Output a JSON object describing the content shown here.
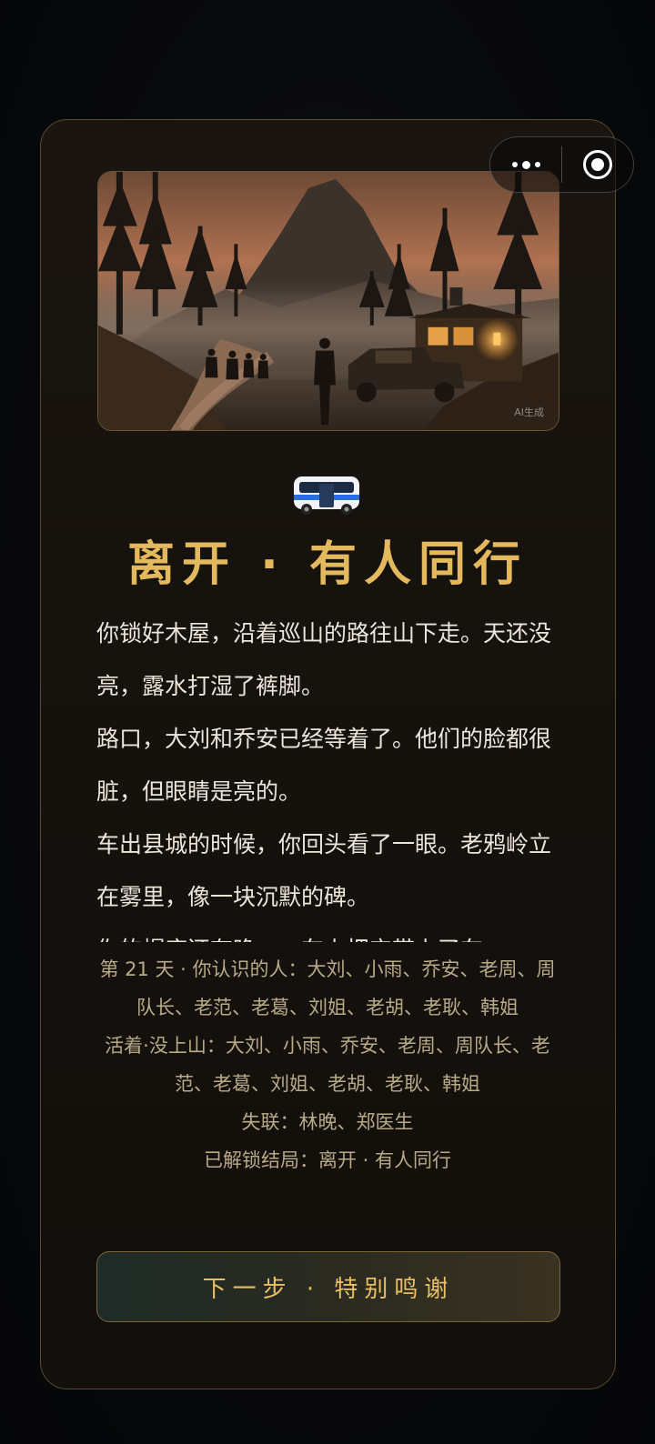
{
  "miniprogram_capsule": {
    "menu_icon": "more-dots-icon",
    "close_icon": "target-close-icon"
  },
  "ending": {
    "scene_watermark": "AI生成",
    "icon": "bus-icon",
    "title": "离开 · 有人同行",
    "story": [
      "你锁好木屋，沿着巡山的路往山下走。天还没亮，露水打湿了裤脚。",
      "路口，大刘和乔安已经等着了。他们的脸都很脏，但眼睛是亮的。",
      "车出县城的时候，你回头看了一眼。老鸦岭立在雾里，像一块沉默的碑。",
      "你的帽座还有晚……车上把它带上了车"
    ],
    "summary": {
      "known_people": "第 21 天 · 你认识的人：大刘、小雨、乔安、老周、周队长、老范、老葛、刘姐、老胡、老耿、韩姐",
      "alive_not_on_mountain": "活着·没上山：大刘、小雨、乔安、老周、周队长、老范、老葛、刘姐、老胡、老耿、韩姐",
      "missing": "失联：林晚、郑医生",
      "unlocked_ending": "已解锁结局：离开 · 有人同行"
    },
    "next_button_label": "下一步 · 特别鸣谢"
  },
  "colors": {
    "accent_gold": "#e4b95e",
    "card_border": "#5a4a2e",
    "story_text": "#ece6da",
    "summary_text": "#b8aa88"
  }
}
